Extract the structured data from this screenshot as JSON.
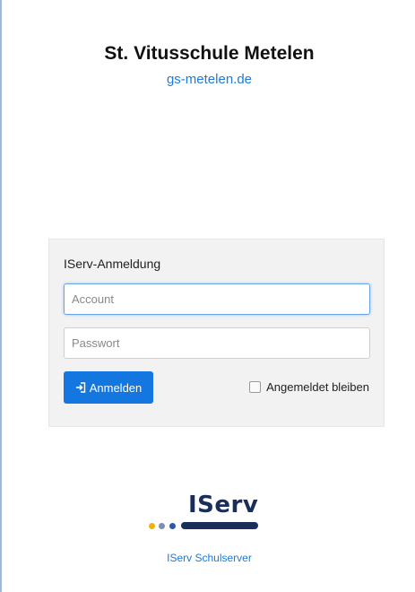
{
  "header": {
    "school_name": "St. Vitusschule Metelen",
    "school_url": "gs-metelen.de"
  },
  "login": {
    "title": "IServ-Anmeldung",
    "account_placeholder": "Account",
    "password_placeholder": "Passwort",
    "submit_label": "Anmelden",
    "remember_label": "Angemeldet bleiben",
    "remember_checked": false
  },
  "footer": {
    "logo_text": "IServ",
    "link_text": "IServ Schulserver"
  },
  "colors": {
    "accent": "#1477e0",
    "link": "#1e7bd8",
    "logo_dark": "#1a2e5a",
    "logo_yellow": "#f0b400"
  },
  "icons": {
    "submit": "sign-in-icon",
    "logo": "iserv-logo"
  }
}
